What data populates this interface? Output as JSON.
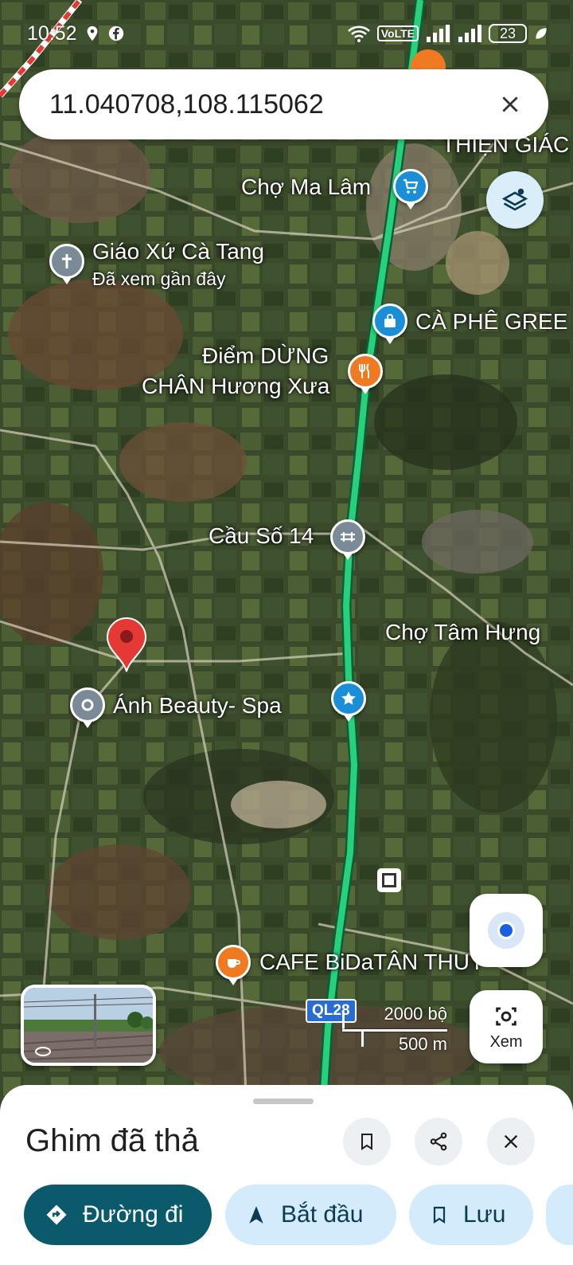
{
  "status_bar": {
    "time": "10:52",
    "network_badge": "VoLTE",
    "battery": "23"
  },
  "search": {
    "value": "11.040708,108.115062"
  },
  "map": {
    "type": "satellite",
    "places": [
      {
        "name": "Chợ Ma Lâm",
        "icon": "shopping-cart-icon",
        "color": "#1a8fd8"
      },
      {
        "name": "Giáo Xứ Cà Tang",
        "subtitle": "Đã xem gần đây",
        "icon": "church-cross-icon",
        "color": "#7a8a96"
      },
      {
        "name": "CÀ PHÊ GREE",
        "icon": "shopping-bag-icon",
        "color": "#1a8fd8"
      },
      {
        "name": "Điểm DỪNG CHÂN Hương Xưa",
        "line1": "Điểm DỪNG",
        "line2": "CHÂN Hương Xưa",
        "icon": "restaurant-icon",
        "color": "#f07a22"
      },
      {
        "name": "Cầu Số 14",
        "icon": "bridge-icon",
        "color": "#7a8a96"
      },
      {
        "name": "Chợ Tâm Hưng"
      },
      {
        "name": "Ánh Beauty- Spa",
        "icon": "location-pin-icon",
        "color": "#7a8a96"
      },
      {
        "name": "CAFE BiDaTÂN THUY",
        "icon": "coffee-cup-icon",
        "color": "#f07a22"
      },
      {
        "name": "THIỆN GIÁC"
      }
    ],
    "dropped_pin_color": "#e53935",
    "highway_color": "#27d07a",
    "route_badge": "QL28",
    "scale": {
      "top": "2000 bộ",
      "bottom": "500 m"
    }
  },
  "buttons": {
    "view_label": "Xem"
  },
  "sheet": {
    "title": "Ghim đã thả",
    "actions": [
      {
        "label": "Đường đi",
        "icon": "directions-icon"
      },
      {
        "label": "Bắt đầu",
        "icon": "navigation-arrow-icon"
      },
      {
        "label": "Lưu",
        "icon": "bookmark-icon"
      }
    ]
  }
}
